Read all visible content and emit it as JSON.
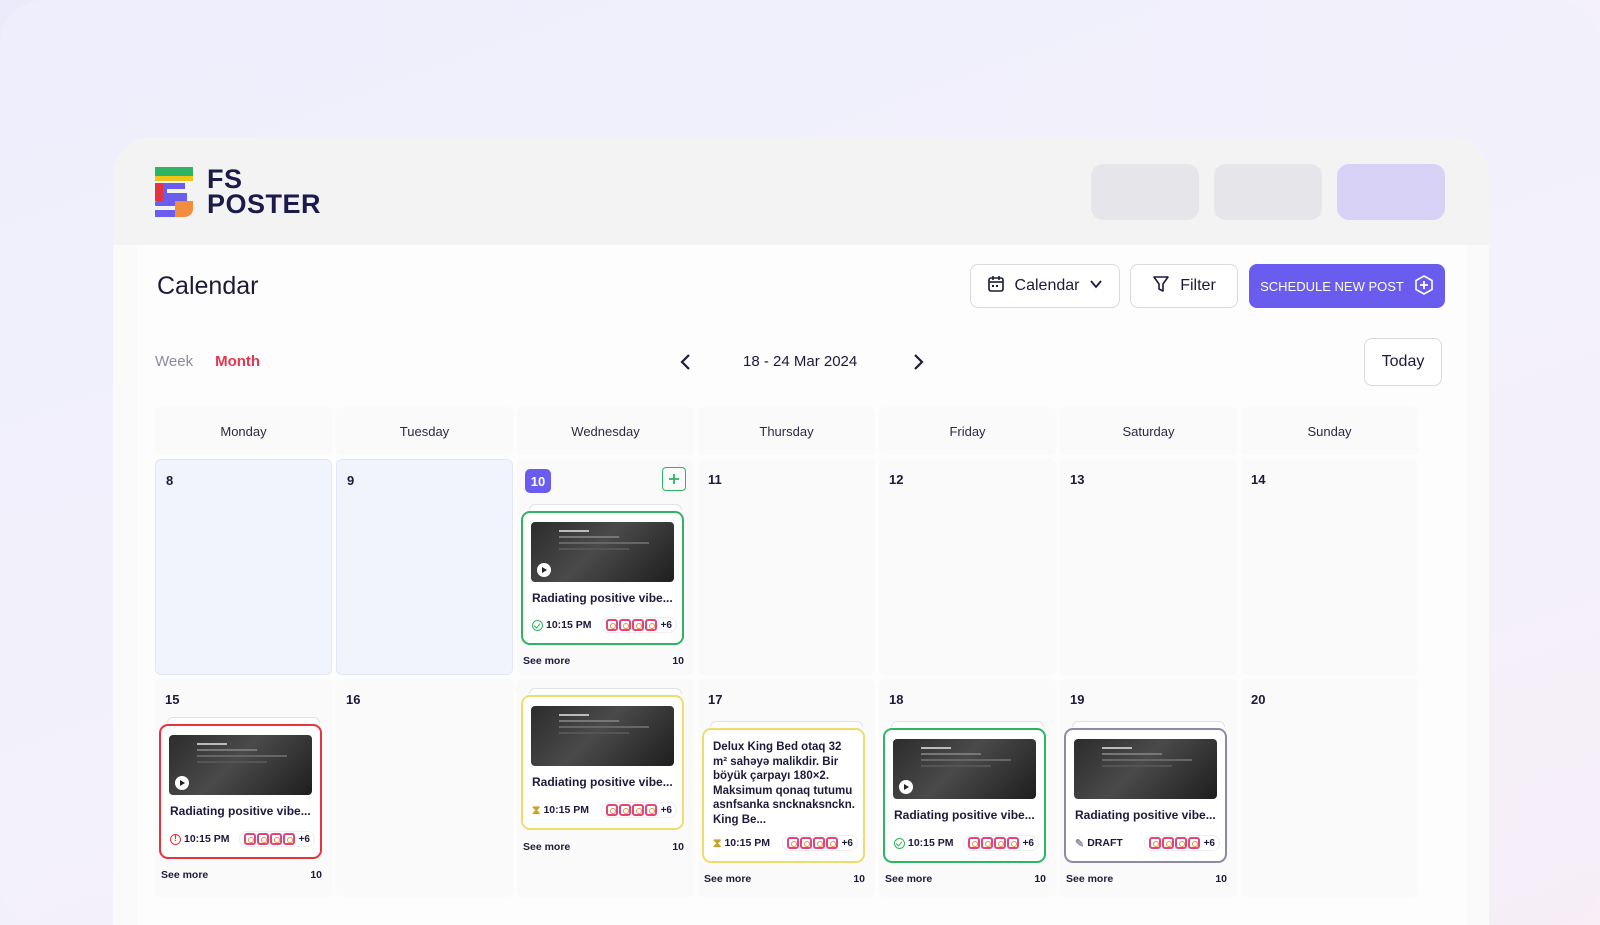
{
  "brand": {
    "line1": "FS",
    "line2": "POSTER"
  },
  "page": {
    "title": "Calendar"
  },
  "toolbar": {
    "calendar_label": "Calendar",
    "filter_label": "Filter",
    "new_post_label": "SCHEDULE NEW POST",
    "today_label": "Today"
  },
  "views": {
    "week": "Week",
    "month": "Month",
    "active": "Month"
  },
  "range": {
    "label": "18 - 24 Mar 2024"
  },
  "days": [
    "Monday",
    "Tuesday",
    "Wednesday",
    "Thursday",
    "Friday",
    "Saturday",
    "Sunday"
  ],
  "week1": {
    "d1": "8",
    "d2": "9",
    "d3": "10",
    "d4": "11",
    "d5": "12",
    "d6": "13",
    "d7": "14"
  },
  "week2": {
    "d1": "15",
    "d2": "16",
    "d3": "",
    "d4": "17",
    "d5": "18",
    "d6": "19",
    "d7": "20"
  },
  "posts": {
    "wed10": {
      "title": "Radiating positive vibe...",
      "time": "10:15 PM",
      "more": "+6",
      "see_more": "See more",
      "count": "10"
    },
    "mon15": {
      "title": "Radiating positive vibe...",
      "time": "10:15 PM",
      "more": "+6",
      "see_more": "See more",
      "count": "10"
    },
    "wed2": {
      "title": "Radiating positive vibe...",
      "time": "10:15 PM",
      "more": "+6",
      "see_more": "See more",
      "count": "10"
    },
    "thu17": {
      "text": "Delux King Bed otaq 32 m² sahəyə malikdir. Bir böyük çarpayı 180×2. Maksimum qonaq tutumu asnfsanka sncknaksnckn. King Be...",
      "time": "10:15 PM",
      "more": "+6",
      "see_more": "See more",
      "count": "10"
    },
    "fri18": {
      "title": "Radiating positive vibe...",
      "time": "10:15 PM",
      "more": "+6",
      "see_more": "See more",
      "count": "10"
    },
    "sat19": {
      "title": "Radiating positive vibe...",
      "status": "DRAFT",
      "more": "+6",
      "see_more": "See more",
      "count": "10"
    }
  },
  "colors": {
    "accent": "#6b5cf0",
    "published": "#2fb462",
    "error": "#e6343f",
    "scheduled": "#f0dc6a",
    "draft": "#8d8aa6",
    "month_active": "#e6344f"
  }
}
